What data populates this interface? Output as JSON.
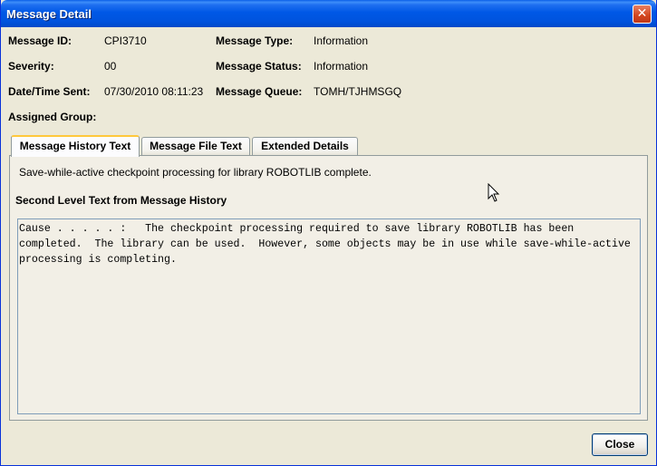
{
  "window": {
    "title": "Message Detail",
    "close_glyph": "✕"
  },
  "fields": {
    "message_id_label": "Message ID:",
    "message_id_value": "CPI3710",
    "severity_label": "Severity:",
    "severity_value": "00",
    "datetime_label": "Date/Time Sent:",
    "datetime_value": "07/30/2010 08:11:23",
    "assigned_group_label": "Assigned Group:",
    "message_type_label": "Message Type:",
    "message_type_value": "Information",
    "message_status_label": "Message Status:",
    "message_status_value": "Information",
    "message_queue_label": "Message Queue:",
    "message_queue_value": "TOMH/TJHMSGQ"
  },
  "tabs": [
    {
      "label": "Message History Text",
      "active": true
    },
    {
      "label": "Message File Text",
      "active": false
    },
    {
      "label": "Extended Details",
      "active": false
    }
  ],
  "panel": {
    "summary": "Save-while-active checkpoint processing for library ROBOTLIB complete.",
    "section_title": "Second Level Text from Message History",
    "detail_text": "Cause . . . . . :   The checkpoint processing required to save library ROBOTLIB has been\ncompleted.  The library can be used.  However, some objects may be in use while save-while-active\nprocessing is completing."
  },
  "buttons": {
    "close_label": "Close"
  },
  "icons": {
    "window_close": "close-icon",
    "pointer": "mouse-pointer-icon"
  },
  "colors": {
    "titlebar": "#0058e6",
    "window_bg": "#ece9d8",
    "active_tab_accent": "#ffc83c"
  }
}
